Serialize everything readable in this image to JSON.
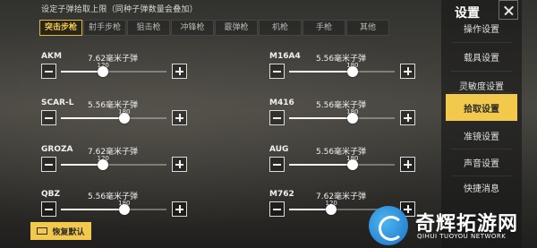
{
  "header": {
    "note": "设定子弹拾取上限（同种子弹数量会叠加）"
  },
  "tabs": [
    {
      "label": "突击步枪",
      "active": true
    },
    {
      "label": "射手步枪",
      "active": false
    },
    {
      "label": "狙击枪",
      "active": false
    },
    {
      "label": "冲锋枪",
      "active": false
    },
    {
      "label": "霰弹枪",
      "active": false
    },
    {
      "label": "机枪",
      "active": false
    },
    {
      "label": "手枪",
      "active": false
    },
    {
      "label": "其他",
      "active": false
    }
  ],
  "weapons": [
    {
      "name": "AKM",
      "ammo": "7.62毫米子弹",
      "value": "120",
      "fraction": 0.4
    },
    {
      "name": "M16A4",
      "ammo": "5.56毫米子弹",
      "value": "180",
      "fraction": 0.6
    },
    {
      "name": "SCAR-L",
      "ammo": "5.56毫米子弹",
      "value": "180",
      "fraction": 0.6
    },
    {
      "name": "M416",
      "ammo": "5.56毫米子弹",
      "value": "180",
      "fraction": 0.6
    },
    {
      "name": "GROZA",
      "ammo": "7.62毫米子弹",
      "value": "120",
      "fraction": 0.4
    },
    {
      "name": "AUG",
      "ammo": "5.56毫米子弹",
      "value": "180",
      "fraction": 0.6
    },
    {
      "name": "QBZ",
      "ammo": "5.56毫米子弹",
      "value": "180",
      "fraction": 0.6
    },
    {
      "name": "M762",
      "ammo": "7.62毫米子弹",
      "value": "120",
      "fraction": 0.4
    }
  ],
  "restore_label": "恢复默认",
  "side": {
    "title": "设置",
    "items": [
      {
        "label": "操作设置",
        "active": false
      },
      {
        "label": "载具设置",
        "active": false
      },
      {
        "label": "灵敏度设置",
        "active": false
      },
      {
        "label": "拾取设置",
        "active": true
      },
      {
        "label": "准镜设置",
        "active": false
      },
      {
        "label": "声音设置",
        "active": false
      },
      {
        "label": "快捷消息",
        "active": false
      }
    ]
  },
  "watermark": {
    "title": "奇辉拓游网",
    "subtitle": "QIHUI TUOYOU NETWORK"
  },
  "colors": {
    "accent": "#f2c94c"
  }
}
